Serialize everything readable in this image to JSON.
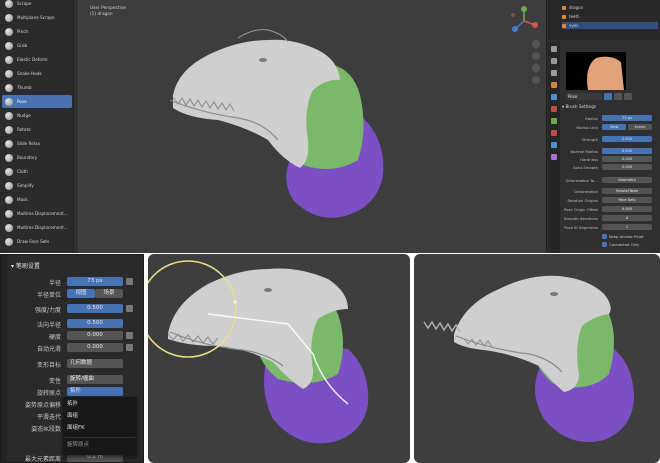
{
  "top": {
    "brushes": [
      {
        "label": "Scrape"
      },
      {
        "label": "Multiplane Scrape"
      },
      {
        "label": "Pinch"
      },
      {
        "label": "Grab"
      },
      {
        "label": "Elastic Deform"
      },
      {
        "label": "Snake Hook"
      },
      {
        "label": "Thumb"
      },
      {
        "label": "Pose"
      },
      {
        "label": "Nudge"
      },
      {
        "label": "Rotate"
      },
      {
        "label": "Slide Relax"
      },
      {
        "label": "Boundary"
      },
      {
        "label": "Cloth"
      },
      {
        "label": "Simplify"
      },
      {
        "label": "Mask"
      },
      {
        "label": "Multires Displacement..."
      },
      {
        "label": "Multires Displacement..."
      },
      {
        "label": "Draw Face Sets"
      }
    ],
    "viewport": {
      "perspective_label": "User Perspective",
      "object_label": "(1) dragon"
    },
    "outliner": {
      "rows": [
        "dragon",
        "teeth",
        "eyes"
      ]
    },
    "brush_name": "Pose",
    "section_title": "Brush Settings",
    "props": [
      {
        "label": "Radius",
        "value": "73 px"
      },
      {
        "label": "Radius Unit",
        "value": "View",
        "value2": "Scene"
      },
      {
        "label": "Strength",
        "value": "0.500"
      },
      {
        "label": "Normal Radius",
        "value": "0.500"
      },
      {
        "label": "Hardness",
        "value": "0.000"
      },
      {
        "label": "Auto-Smooth",
        "value": "0.000"
      },
      {
        "label": "Deformation Ta...",
        "value": "Geometry"
      },
      {
        "label": "Deformation",
        "value": "Rotate/Twist"
      },
      {
        "label": "Rotation Origins",
        "value": "Face Sets"
      },
      {
        "label": "Pose Origin Offset",
        "value": "0.000"
      },
      {
        "label": "Smooth Iterations",
        "value": "4"
      },
      {
        "label": "Pose IK Segments",
        "value": "1"
      }
    ],
    "checkboxes": [
      "Keep Anchor Point",
      "Connected Only"
    ]
  },
  "bottom_left": {
    "title": "笔刷设置",
    "rows": [
      {
        "label": "半径",
        "value": "73 px"
      },
      {
        "label": "半径单位",
        "value": "视图",
        "value2": "场景"
      },
      {
        "label": "强度/力度",
        "value": "0.500"
      },
      {
        "label": "法向半径",
        "value": "0.500"
      },
      {
        "label": "硬度",
        "value": "0.000"
      },
      {
        "label": "自动光滑",
        "value": "0.000"
      },
      {
        "label": "变形目标",
        "value": "几何数据"
      },
      {
        "label": "变性",
        "value": "旋转/缠曲"
      },
      {
        "label": "旋转原点",
        "value": "拓扑"
      },
      {
        "label": "姿势原点偏移",
        "value": ""
      },
      {
        "label": "平滑迭代",
        "value": ""
      },
      {
        "label": "姿态IK段数",
        "value": ""
      },
      {
        "label": "最大元素距离",
        "value": "0.1 m"
      }
    ],
    "dropdown": [
      "拓扑",
      "面组",
      "面组FK",
      "旋转原点"
    ]
  },
  "colors": {
    "viewport_bg": "#3d3d3d",
    "clay": "#cfcfcf",
    "green": "#7ab86a",
    "purple": "#7c4fc4",
    "accent": "#4772b3",
    "brush_circle": "#e6e08a"
  }
}
